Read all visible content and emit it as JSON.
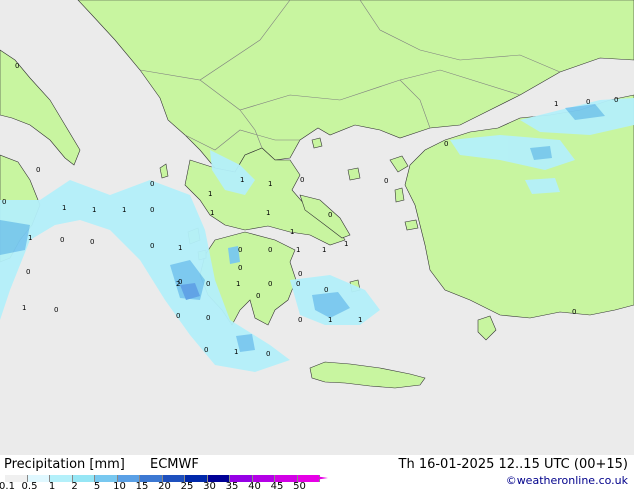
{
  "title": {
    "product": "Precipitation [mm]",
    "model": "ECMWF",
    "valid_time": "Th 16-01-2025 12..15 UTC (00+15)"
  },
  "credit": "©weatheronline.co.uk",
  "legend": {
    "ticks": [
      "0.1",
      "0.5",
      "1",
      "2",
      "5",
      "10",
      "15",
      "20",
      "25",
      "30",
      "35",
      "40",
      "45",
      "50"
    ],
    "colors": [
      "#f0f0f0",
      "#e0f8ff",
      "#b4f0fa",
      "#96e6f5",
      "#78c8f0",
      "#5aa0e6",
      "#3c78d2",
      "#1e50be",
      "#0028aa",
      "#000096",
      "#9600e6",
      "#b400e6",
      "#d200e6",
      "#e600e6"
    ]
  },
  "colors": {
    "sea": "#ebebeb",
    "land": "#c8f5a0",
    "border": "#7f7f7f",
    "coast": "#333333"
  },
  "values": [
    "0",
    "1",
    "1",
    "1",
    "0",
    "1",
    "1",
    "0",
    "0",
    "0",
    "1",
    "0",
    "0",
    "0",
    "1",
    "0",
    "0",
    "0",
    "0",
    "1",
    "0",
    "0",
    "0",
    "1",
    "1",
    "0",
    "1",
    "0",
    "1",
    "0",
    "0",
    "0",
    "0",
    "0",
    "1",
    "1",
    "0",
    "2",
    "0",
    "0",
    "0",
    "1",
    "0",
    "0",
    "0",
    "0",
    "0",
    "1",
    "1",
    "1",
    "1",
    "1",
    "0"
  ]
}
